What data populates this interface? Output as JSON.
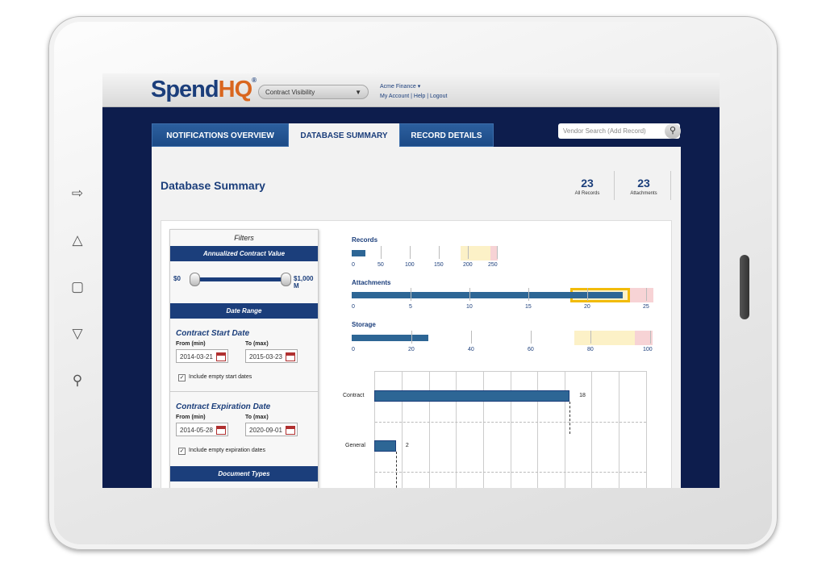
{
  "header": {
    "logo_main": "Spend",
    "logo_accent": "HQ",
    "logo_mark": "®",
    "module": "Contract Visibility",
    "account_name": "Acme Finance",
    "account_links": "My Account | Help | Logout"
  },
  "tabs": [
    {
      "label": "NOTIFICATIONS OVERVIEW",
      "active": false
    },
    {
      "label": "DATABASE SUMMARY",
      "active": true
    },
    {
      "label": "RECORD DETAILS",
      "active": false
    }
  ],
  "search": {
    "placeholder": "Vendor Search (Add Record)"
  },
  "page": {
    "title": "Database Summary",
    "stats": [
      {
        "value": "23",
        "label": "All Records"
      },
      {
        "value": "23",
        "label": "Attachments"
      }
    ]
  },
  "filters": {
    "title": "Filters",
    "acv_band": "Annualized Contract Value",
    "acv_min": "$0",
    "acv_max": "$1,000 M",
    "date_band": "Date Range",
    "start": {
      "heading": "Contract Start Date",
      "from_label": "From (min)",
      "from_value": "2014-03-21",
      "to_label": "To (max)",
      "to_value": "2015-03-23",
      "include_label": "Include empty start dates",
      "include_checked": true
    },
    "expiration": {
      "heading": "Contract Expiration Date",
      "from_label": "From (min)",
      "from_value": "2014-05-28",
      "to_label": "To (max)",
      "to_value": "2020-09-01",
      "include_label": "Include empty expiration dates",
      "include_checked": true
    },
    "doc_types_band": "Document Types"
  },
  "metrics": [
    {
      "title": "Records",
      "ticks": [
        "0",
        "50",
        "100",
        "150",
        "200",
        "250"
      ],
      "value": 12
    },
    {
      "title": "Attachments",
      "ticks": [
        "0",
        "5",
        "10",
        "15",
        "20",
        "25"
      ],
      "value": 23
    },
    {
      "title": "Storage",
      "ticks": [
        "0",
        "20",
        "40",
        "60",
        "80",
        "100"
      ],
      "value": 26
    }
  ],
  "chart_data": {
    "type": "bar",
    "orientation": "horizontal",
    "categories": [
      "Contract",
      "General"
    ],
    "values": [
      18,
      2
    ],
    "value_labels": [
      "18",
      "2"
    ]
  },
  "colors": {
    "navy": "#0d1d4d",
    "brand_blue": "#1b3e7b",
    "brand_orange": "#d9661f",
    "bar": "#2d6695",
    "warn_yellow": "#fcf1c7",
    "alert_red": "#f7d3d5",
    "highlight": "#f2bb0a"
  }
}
